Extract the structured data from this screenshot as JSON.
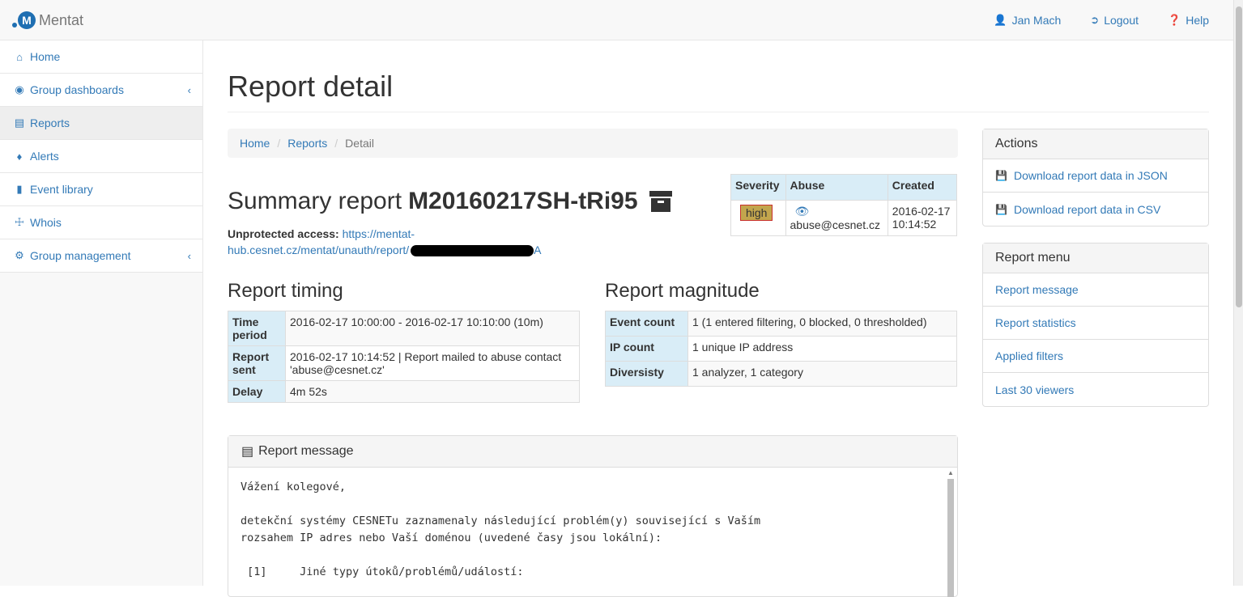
{
  "app": {
    "name": "Mentat",
    "logo_letter": "M"
  },
  "topnav": {
    "user": "Jan Mach",
    "logout": "Logout",
    "help": "Help"
  },
  "sidebar": {
    "items": [
      {
        "label": "Home",
        "icon": "home-icon"
      },
      {
        "label": "Group dashboards",
        "icon": "dashboard-icon",
        "has_submenu": true
      },
      {
        "label": "Reports",
        "icon": "newspaper-icon",
        "active": true
      },
      {
        "label": "Alerts",
        "icon": "bell-icon"
      },
      {
        "label": "Event library",
        "icon": "book-icon"
      },
      {
        "label": "Whois",
        "icon": "signpost-icon"
      },
      {
        "label": "Group management",
        "icon": "cogs-icon",
        "has_submenu": true
      }
    ]
  },
  "page": {
    "title": "Report detail"
  },
  "breadcrumb": {
    "home": "Home",
    "reports": "Reports",
    "current": "Detail"
  },
  "summary": {
    "prefix": "Summary report",
    "report_id": "M20160217SH-tRi95",
    "unprotected_label": "Unprotected access:",
    "unprotected_url_visible": "https://mentat-hub.cesnet.cz/mentat/unauth/report/",
    "unprotected_url_tail": "A"
  },
  "info_table": {
    "headers": {
      "severity": "Severity",
      "abuse": "Abuse",
      "created": "Created"
    },
    "severity": "high",
    "abuse": "abuse@cesnet.cz",
    "created_date": "2016-02-17",
    "created_time": "10:14:52"
  },
  "timing": {
    "title": "Report timing",
    "rows": [
      {
        "label": "Time period",
        "value": "2016-02-17 10:00:00 - 2016-02-17 10:10:00 (10m)"
      },
      {
        "label": "Report sent",
        "value": "2016-02-17 10:14:52 | Report mailed to abuse contact 'abuse@cesnet.cz'"
      },
      {
        "label": "Delay",
        "value": "4m 52s"
      }
    ]
  },
  "magnitude": {
    "title": "Report magnitude",
    "rows": [
      {
        "label": "Event count",
        "value": "1 (1 entered filtering, 0 blocked, 0 thresholded)"
      },
      {
        "label": "IP count",
        "value": "1 unique IP address"
      },
      {
        "label": "Diversisty",
        "value": "1 analyzer, 1 category"
      }
    ]
  },
  "message": {
    "title": "Report message",
    "text": "Vážení kolegové,\n\ndetekční systémy CESNETu zaznamenaly následující problém(y) související s Vaším\nrozsahem IP adres nebo Vaší doménou (uvedené časy jsou lokální):\n\n [1]     Jiné typy útoků/problémů/událostí:"
  },
  "actions": {
    "title": "Actions",
    "items": [
      "Download report data in JSON",
      "Download report data in CSV"
    ]
  },
  "report_menu": {
    "title": "Report menu",
    "items": [
      "Report message",
      "Report statistics",
      "Applied filters",
      "Last 30 viewers"
    ]
  }
}
